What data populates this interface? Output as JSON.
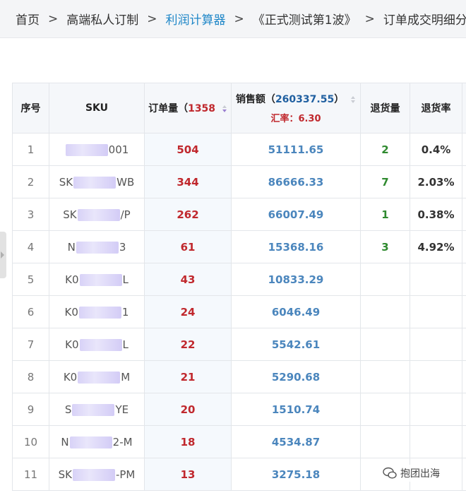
{
  "breadcrumb": {
    "items": [
      "首页",
      "高端私人订制",
      "利润计算器",
      "《正式测试第1波》",
      "订单成交明细分"
    ],
    "separator": ">"
  },
  "table": {
    "headers": {
      "index": "序号",
      "sku": "SKU",
      "order_qty": "订单量（",
      "order_qty_total": "1358",
      "sales": "销售额（",
      "sales_total": "260337.55",
      "sales_close": "）",
      "exchange_rate": "汇率：6.30",
      "return_qty": "退货量",
      "return_rate": "退货率"
    },
    "rows": [
      {
        "index": "1",
        "sku_a": "",
        "sku_b": "001",
        "qty": "504",
        "sales": "51111.65",
        "return_qty": "2",
        "return_rate": "0.4%"
      },
      {
        "index": "2",
        "sku_a": "SK",
        "sku_b": "WB",
        "qty": "344",
        "sales": "86666.33",
        "return_qty": "7",
        "return_rate": "2.03%"
      },
      {
        "index": "3",
        "sku_a": "SK",
        "sku_b": "/P",
        "qty": "262",
        "sales": "66007.49",
        "return_qty": "1",
        "return_rate": "0.38%"
      },
      {
        "index": "4",
        "sku_a": "N",
        "sku_b": "3",
        "qty": "61",
        "sales": "15368.16",
        "return_qty": "3",
        "return_rate": "4.92%"
      },
      {
        "index": "5",
        "sku_a": "K0",
        "sku_b": "L",
        "qty": "43",
        "sales": "10833.29",
        "return_qty": "",
        "return_rate": ""
      },
      {
        "index": "6",
        "sku_a": "K0",
        "sku_b": "1",
        "qty": "24",
        "sales": "6046.49",
        "return_qty": "",
        "return_rate": ""
      },
      {
        "index": "7",
        "sku_a": "K0",
        "sku_b": "L",
        "qty": "22",
        "sales": "5542.61",
        "return_qty": "",
        "return_rate": ""
      },
      {
        "index": "8",
        "sku_a": "K0",
        "sku_b": "M",
        "qty": "21",
        "sales": "5290.68",
        "return_qty": "",
        "return_rate": ""
      },
      {
        "index": "9",
        "sku_a": "S",
        "sku_b": "YE",
        "qty": "20",
        "sales": "1510.74",
        "return_qty": "",
        "return_rate": ""
      },
      {
        "index": "10",
        "sku_a": "N",
        "sku_b": "2-M",
        "qty": "18",
        "sales": "4534.87",
        "return_qty": "",
        "return_rate": ""
      },
      {
        "index": "11",
        "sku_a": "SK",
        "sku_b": "-PM",
        "qty": "13",
        "sales": "3275.18",
        "return_qty": "",
        "return_rate": ""
      }
    ]
  },
  "watermark": {
    "text": "抱团出海"
  },
  "colors": {
    "link": "#1f87c8",
    "qty_red": "#c0282d",
    "sales_blue": "#4b86bd",
    "return_green": "#2f8a2f"
  }
}
